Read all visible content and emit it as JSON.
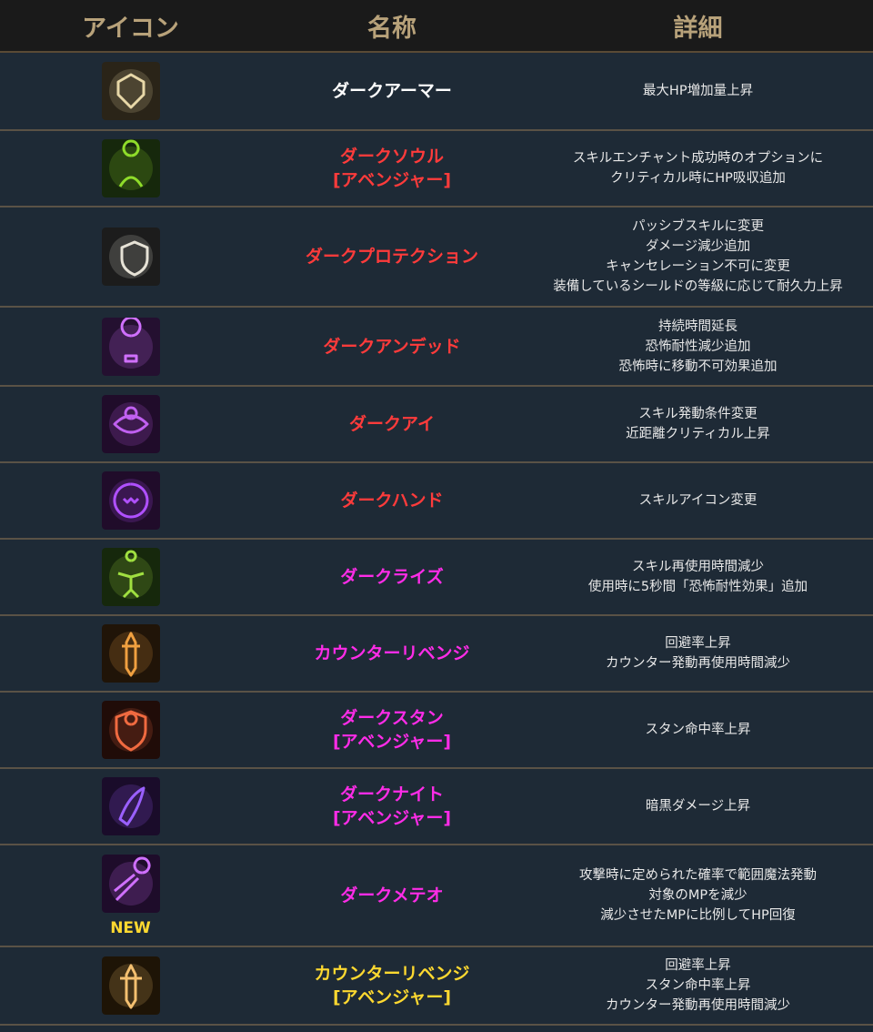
{
  "headers": {
    "icon": "アイコン",
    "name": "名称",
    "detail": "詳細"
  },
  "colors": {
    "white": "#ffffff",
    "red": "#ff3b3b",
    "magenta": "#ff2ce8",
    "yellow": "#ffd930"
  },
  "rows": [
    {
      "name": [
        "ダークアーマー"
      ],
      "color": "white",
      "icon": "dark-armor-icon",
      "details": [
        "最大HP増加量上昇"
      ]
    },
    {
      "name": [
        "ダークソウル",
        "[アベンジャー]"
      ],
      "color": "red",
      "icon": "dark-soul-icon",
      "details": [
        "スキルエンチャント成功時のオプションに",
        "クリティカル時にHP吸収追加"
      ]
    },
    {
      "name": [
        "ダークプロテクション"
      ],
      "color": "red",
      "icon": "dark-protection-icon",
      "details": [
        "パッシブスキルに変更",
        "ダメージ減少追加",
        "キャンセレーション不可に変更",
        "装備しているシールドの等級に応じて耐久力上昇"
      ]
    },
    {
      "name": [
        "ダークアンデッド"
      ],
      "color": "red",
      "icon": "dark-undead-icon",
      "details": [
        "持続時間延長",
        "恐怖耐性減少追加",
        "恐怖時に移動不可効果追加"
      ]
    },
    {
      "name": [
        "ダークアイ"
      ],
      "color": "red",
      "icon": "dark-eye-icon",
      "details": [
        "スキル発動条件変更",
        "近距離クリティカル上昇"
      ]
    },
    {
      "name": [
        "ダークハンド"
      ],
      "color": "red",
      "icon": "dark-hand-icon",
      "details": [
        "スキルアイコン変更"
      ]
    },
    {
      "name": [
        "ダークライズ"
      ],
      "color": "magenta",
      "icon": "dark-rise-icon",
      "details": [
        "スキル再使用時間減少",
        "使用時に5秒間「恐怖耐性効果」追加"
      ]
    },
    {
      "name": [
        "カウンターリベンジ"
      ],
      "color": "magenta",
      "icon": "counter-revenge-icon",
      "details": [
        "回避率上昇",
        "カウンター発動再使用時間減少"
      ]
    },
    {
      "name": [
        "ダークスタン",
        "[アベンジャー]"
      ],
      "color": "magenta",
      "icon": "dark-stun-icon",
      "details": [
        "スタン命中率上昇"
      ]
    },
    {
      "name": [
        "ダークナイト",
        "[アベンジャー]"
      ],
      "color": "magenta",
      "icon": "dark-knight-icon",
      "details": [
        "暗黒ダメージ上昇"
      ]
    },
    {
      "name": [
        "ダークメテオ"
      ],
      "color": "magenta",
      "icon": "dark-meteor-icon",
      "badge": "NEW",
      "details": [
        "攻撃時に定められた確率で範囲魔法発動",
        "対象のMPを減少",
        "減少させたMPに比例してHP回復"
      ]
    },
    {
      "name": [
        "カウンターリベンジ",
        "[アベンジャー]"
      ],
      "color": "yellow",
      "icon": "counter-revenge-avenger-icon",
      "details": [
        "回避率上昇",
        "スタン命中率上昇",
        "カウンター発動再使用時間減少"
      ]
    }
  ]
}
